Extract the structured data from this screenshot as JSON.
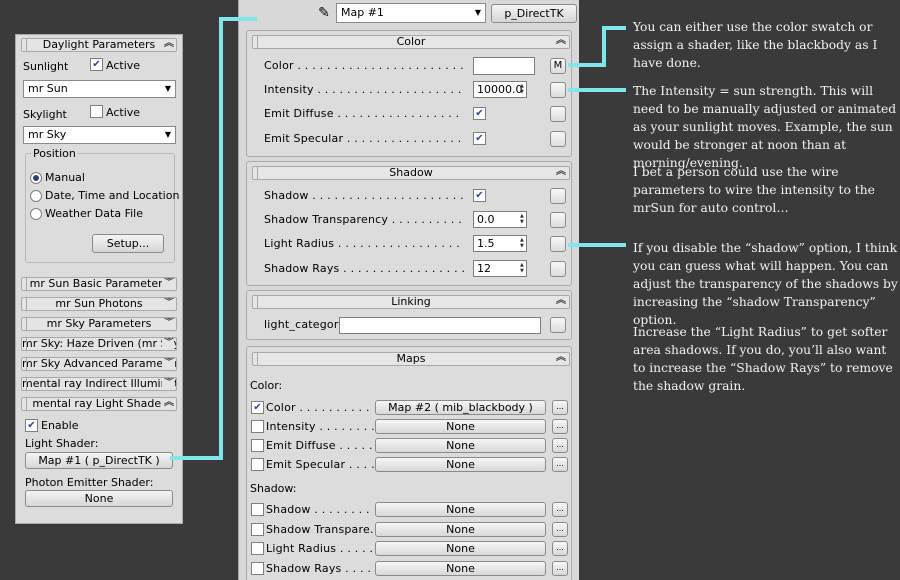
{
  "left_panel": {
    "daylight_title": "Daylight Parameters",
    "sunlight_label": "Sunlight",
    "sunlight_active_label": "Active",
    "sunlight_active_checked": true,
    "sunlight_value": "mr Sun",
    "skylight_label": "Skylight",
    "skylight_active_label": "Active",
    "skylight_active_checked": false,
    "skylight_value": "mr Sky",
    "position_title": "Position",
    "position_options": [
      "Manual",
      "Date, Time and Location",
      "Weather Data File"
    ],
    "position_selected": "Manual",
    "setup_button": "Setup...",
    "rollouts": [
      "mr Sun Basic Parameters",
      "mr Sun Photons",
      "mr Sky Parameters",
      "mr Sky: Haze Driven (mr Sky)",
      "mr Sky Advanced Parameters",
      "mental ray Indirect Illumination",
      "mental ray Light Shader"
    ],
    "enable_label": "Enable",
    "enable_checked": true,
    "light_shader_label": "Light Shader:",
    "light_shader_value": "Map #1  ( p_DirectTK )",
    "photon_label": "Photon Emitter Shader:",
    "photon_value": "None"
  },
  "top_bar": {
    "map_select": "Map #1",
    "shader_button": "p_DirectTK",
    "eyedropper_icon": "eyedropper-icon"
  },
  "color_section": {
    "title": "Color",
    "rows": [
      {
        "label": "Color . . . . . . . . . . . . . . . . . . . . . . .",
        "value": "",
        "side_button": "M"
      },
      {
        "label": "Intensity . . . . . . . . . . . . . . . . . . . .",
        "value": "10000.0",
        "side_button": ""
      },
      {
        "label": "Emit Diffuse . . . . . . . . . . . . . . . . .",
        "checked": true,
        "side_button": ""
      },
      {
        "label": "Emit Specular . . . . . . . . . . . . . . . .",
        "checked": true,
        "side_button": ""
      }
    ]
  },
  "shadow_section": {
    "title": "Shadow",
    "rows": [
      {
        "label": "Shadow . . . . . . . . . . . . . . . . . . . . .",
        "checked": true
      },
      {
        "label": "Shadow Transparency . . . . . . . . . .",
        "value": "0.0"
      },
      {
        "label": "Light Radius . . . . . . . . . . . . . . . . .",
        "value": "1.5"
      },
      {
        "label": "Shadow Rays . . . . . . . . . . . . . . . . .",
        "value": "12"
      }
    ]
  },
  "linking_section": {
    "title": "Linking",
    "label": "light_category",
    "value": ""
  },
  "maps_section": {
    "title": "Maps",
    "color_group": "Color:",
    "color_rows": [
      {
        "label": "Color . . . . . . . . . . .",
        "checked": true,
        "map": "Map #2  ( mib_blackbody )"
      },
      {
        "label": "Intensity . . . . . . . . .",
        "checked": false,
        "map": "None"
      },
      {
        "label": "Emit Diffuse . . . . . . .",
        "checked": false,
        "map": "None"
      },
      {
        "label": "Emit Specular . . . . . . .",
        "checked": false,
        "map": "None"
      }
    ],
    "shadow_group": "Shadow:",
    "shadow_rows": [
      {
        "label": "Shadow . . . . . . . . . .",
        "checked": false,
        "map": "None"
      },
      {
        "label": "Shadow Transpare...",
        "checked": false,
        "map": "None"
      },
      {
        "label": "Light Radius . . . . . . .",
        "checked": false,
        "map": "None"
      },
      {
        "label": "Shadow Rays . . . . . . .",
        "checked": false,
        "map": "None"
      }
    ],
    "mini_button": "..."
  },
  "annotations": [
    "You can either use the color swatch or assign a shader, like the blackbody as I have done.",
    "The Intensity = sun strength.  This will need to be manually adjusted or animated as your sunlight moves.  Example, the sun would be stronger at noon than at morning/evening.",
    "I bet a person could use the wire parameters to wire the intensity to the mrSun for auto control…",
    "If  you disable the “shadow” option, I think you can guess what will happen.  You can adjust the transparency of  the shadows by increasing the “shadow Transparency” option.",
    "Increase the “Light Radius” to get softer area shadows.  If  you do, you’ll also want to increase the “Shadow Rays” to remove the shadow grain."
  ],
  "colors": {
    "background": "#3a3a3a",
    "panel": "#dcdcdc",
    "callout_line": "#7fe6ee",
    "annotation_text": "#f2f2f2"
  }
}
